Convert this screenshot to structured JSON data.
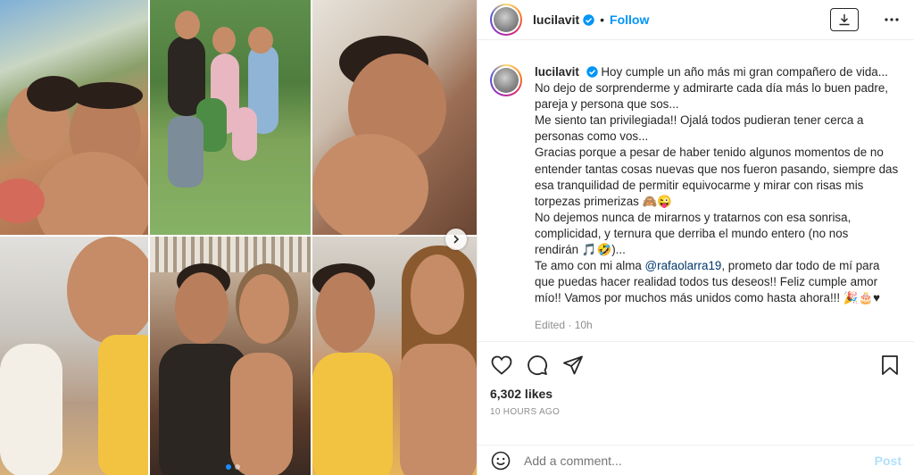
{
  "post": {
    "username": "lucilavit",
    "separator": "•",
    "follow_label": "Follow",
    "caption": {
      "lines": [
        "Hoy cumple un año más mi gran compañero de vida...",
        "No dejo de sorprenderme y admirarte cada día más lo buen padre,",
        "pareja y persona que sos...",
        "Me siento tan privilegiada!! Ojalá todos pudieran tener cerca a",
        "personas como vos...",
        "Gracias porque a pesar de haber tenido algunos momentos de no",
        "entender tantas cosas nuevas que nos fueron pasando, siempre das",
        "esa tranquilidad de permitir equivocarme y mirar con risas mis",
        "torpezas primerizas 🙈😜",
        "No dejemos nunca de mirarnos y tratarnos con esa sonrisa,",
        "complicidad, y ternura que derriba el mundo entero (no nos",
        "rendirán 🎵🤣)...",
        "",
        ", prometo dar todo de mí para",
        "que puedas hacer realidad todos tus deseos!! Feliz cumple amor",
        "mío!! Vamos por muchos más unidos como hasta ahora!!! 🎉🎂♥"
      ],
      "mention_prefix": "Te amo con mi alma ",
      "mention": "@rafaolarra19"
    },
    "edited_label": "Edited",
    "edited_separator": " · ",
    "edited_time": "10h",
    "likes": "6,302 likes",
    "time_ago": "10 HOURS AGO",
    "comment_placeholder": "Add a comment...",
    "post_label": "Post"
  },
  "carousel": {
    "slide_count": 2,
    "active_slide": 1
  },
  "colors": {
    "accent": "#0095f6",
    "mention": "#00376b",
    "muted": "#8e8e8e",
    "post_disabled": "#b2dffc"
  }
}
